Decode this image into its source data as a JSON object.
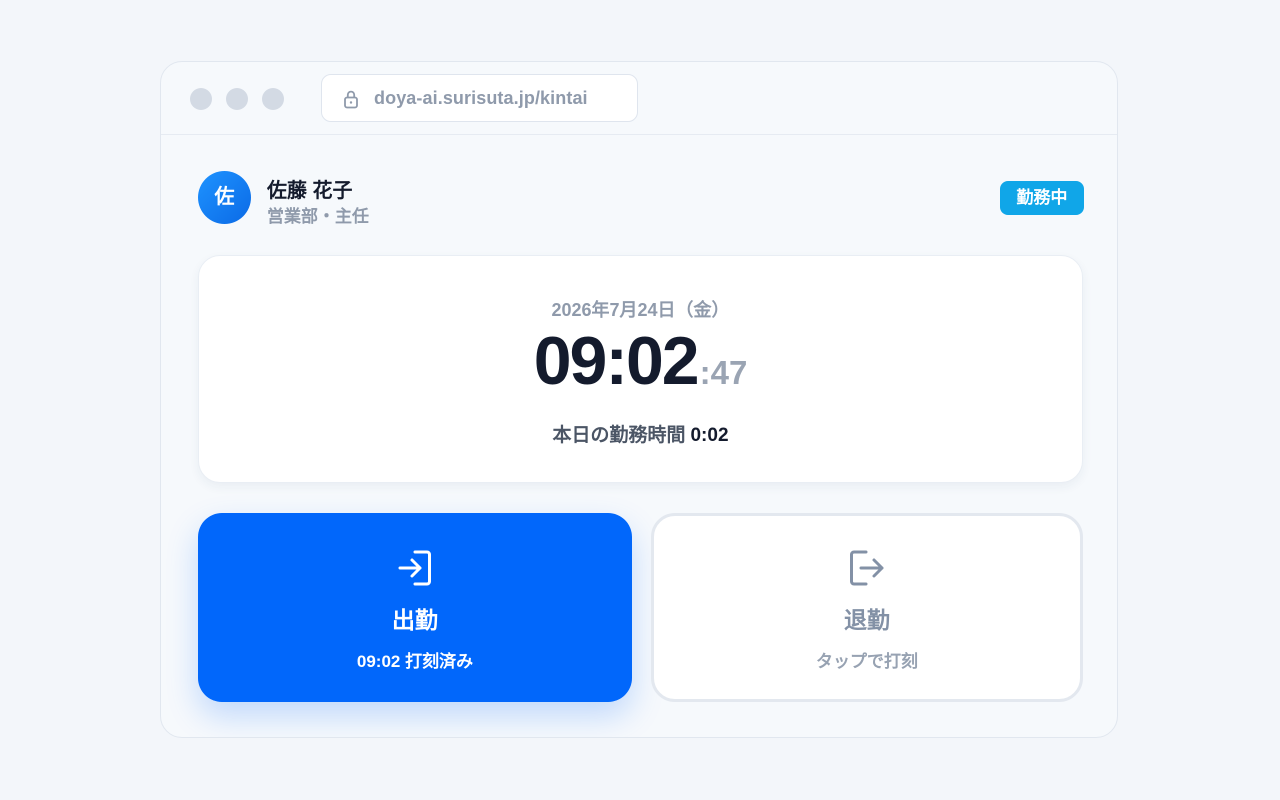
{
  "browser": {
    "url": "doya-ai.surisuta.jp/kintai",
    "icons": [
      "lock-icon"
    ]
  },
  "user": {
    "avatar_initial": "佐",
    "name": "佐藤 花子",
    "role": "営業部・主任",
    "status": "勤務中"
  },
  "clock": {
    "date": "2026年7月24日（金）",
    "time_hm": "09:02",
    "time_sec": ":47",
    "worked_label": "本日の勤務時間",
    "worked_value": "0:02"
  },
  "actions": {
    "clock_in": {
      "label": "出勤",
      "sub": "09:02 打刻済み",
      "icon": "login-icon"
    },
    "clock_out": {
      "label": "退勤",
      "sub": "タップで打刻",
      "icon": "logout-icon"
    }
  },
  "colors": {
    "primary": "#0167fb",
    "status_badge": "#10a6e8",
    "text_dark": "#141b2d",
    "text_muted": "#8f9aab"
  }
}
